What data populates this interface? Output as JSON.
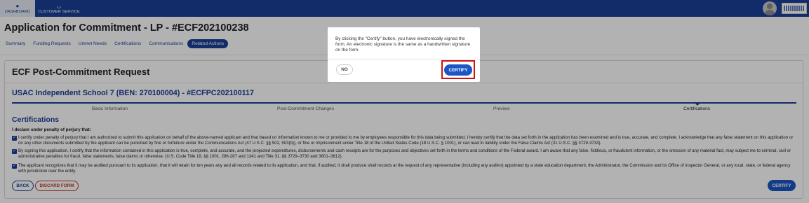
{
  "nav": {
    "items": [
      {
        "label": "DASHBOARD",
        "icon": "dashboard-icon",
        "active": true
      },
      {
        "label": "CUSTOMER SERVICE",
        "icon": "headset-icon",
        "active": false
      }
    ]
  },
  "page": {
    "title": "Application for Commitment - LP - #ECF202100238",
    "tabs": [
      "Summary",
      "Funding Requests",
      "Unmet Needs",
      "Certifications",
      "Communications",
      "Related Actions"
    ],
    "active_tab": "Related Actions"
  },
  "card": {
    "title": "ECF Post-Commitment Request",
    "school": "USAC Independent School 7 (BEN: 270100004) - #ECFPC202100117",
    "steps": [
      "Basic Information",
      "Post-Commitment Changes",
      "Preview",
      "Certifications"
    ],
    "active_step": "Certifications",
    "section_title": "Certifications",
    "declare": "I declare under penalty of perjury that:",
    "certifications": [
      {
        "checked": true,
        "text": "I certify under penalty of perjury that I am authorized to submit this application on behalf of the above-named applicant and that based on information known to me or provided to me by employees responsible for this data being submitted, I hereby certify that the data set forth in the application has been examined and is true, accurate, and complete. I acknowledge that any false statement on this application or on any other documents submitted by the applicant can be punished by fine or forfeiture under the Communications Act (47 U.S.C. §§ 502, 503(b)), or fine or imprisonment under Title 18 of the United States Code (18 U.S.C. § 1001), or can lead to liability under the False Claims Act (31 U.S.C. §§ 3729-3733)."
      },
      {
        "checked": true,
        "text": "By signing this application, I certify that the information contained in this application is true, complete, and accurate, and the projected expenditures, disbursements and cash receipts are for the purposes and objectives set forth in the terms and conditions of the Federal award. I am aware that any false, fictitious, or fraudulent information, or the omission of any material fact, may subject me to criminal, civil or administrative penalties for fraud, false statements, false claims or otherwise. (U.S. Code Title 18, §§ 1001, 286-287 and 1341 and Title 31, §§ 3729–3730 and 3801–3812)."
      },
      {
        "checked": true,
        "text": "The applicant recognizes that it may be audited pursuant to its application, that it will retain for ten years any and all records related to its application, and that, if audited, it shall produce shall records at the request of any representative (including any auditor) appointed by a state education department, the Administrator, the Commission and its Office of Inspector General, or any local, state, or federal agency with jurisdiction over the entity."
      }
    ],
    "back_label": "BACK",
    "discard_label": "DISCARD FORM",
    "certify_label": "CERTIFY"
  },
  "modal": {
    "text": "By clicking the \"Certify\" button, you have electronically signed the form. An electronic signature is the same as a handwritten signature on the form.",
    "no_label": "NO",
    "certify_label": "CERTIFY"
  },
  "colors": {
    "brand": "#1a3f97",
    "primary_button": "#1a56c4",
    "danger": "#c0392b",
    "highlight": "#d01010"
  }
}
